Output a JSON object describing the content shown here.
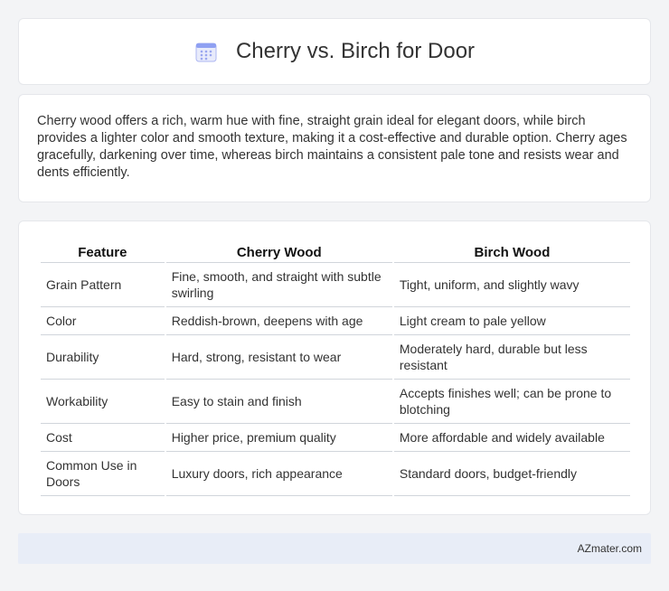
{
  "header": {
    "title": "Cherry vs. Birch for Door",
    "icon": "calendar-icon"
  },
  "summary": {
    "text": "Cherry wood offers a rich, warm hue with fine, straight grain ideal for elegant doors, while birch provides a lighter color and smooth texture, making it a cost-effective and durable option. Cherry ages gracefully, darkening over time, whereas birch maintains a consistent pale tone and resists wear and dents efficiently."
  },
  "table": {
    "headers": [
      "Feature",
      "Cherry Wood",
      "Birch Wood"
    ],
    "rows": [
      [
        "Grain Pattern",
        "Fine, smooth, and straight with subtle swirling",
        "Tight, uniform, and slightly wavy"
      ],
      [
        "Color",
        "Reddish-brown, deepens with age",
        "Light cream to pale yellow"
      ],
      [
        "Durability",
        "Hard, strong, resistant to wear",
        "Moderately hard, durable but less resistant"
      ],
      [
        "Workability",
        "Easy to stain and finish",
        "Accepts finishes well; can be prone to blotching"
      ],
      [
        "Cost",
        "Higher price, premium quality",
        "More affordable and widely available"
      ],
      [
        "Common Use in Doors",
        "Luxury doors, rich appearance",
        "Standard doors, budget-friendly"
      ]
    ]
  },
  "footer": {
    "brand": "AZmater.com"
  },
  "colors": {
    "background": "#f3f4f6",
    "card": "#ffffff",
    "footer": "#e8edf7",
    "icon_accent": "#7c8cf0"
  }
}
